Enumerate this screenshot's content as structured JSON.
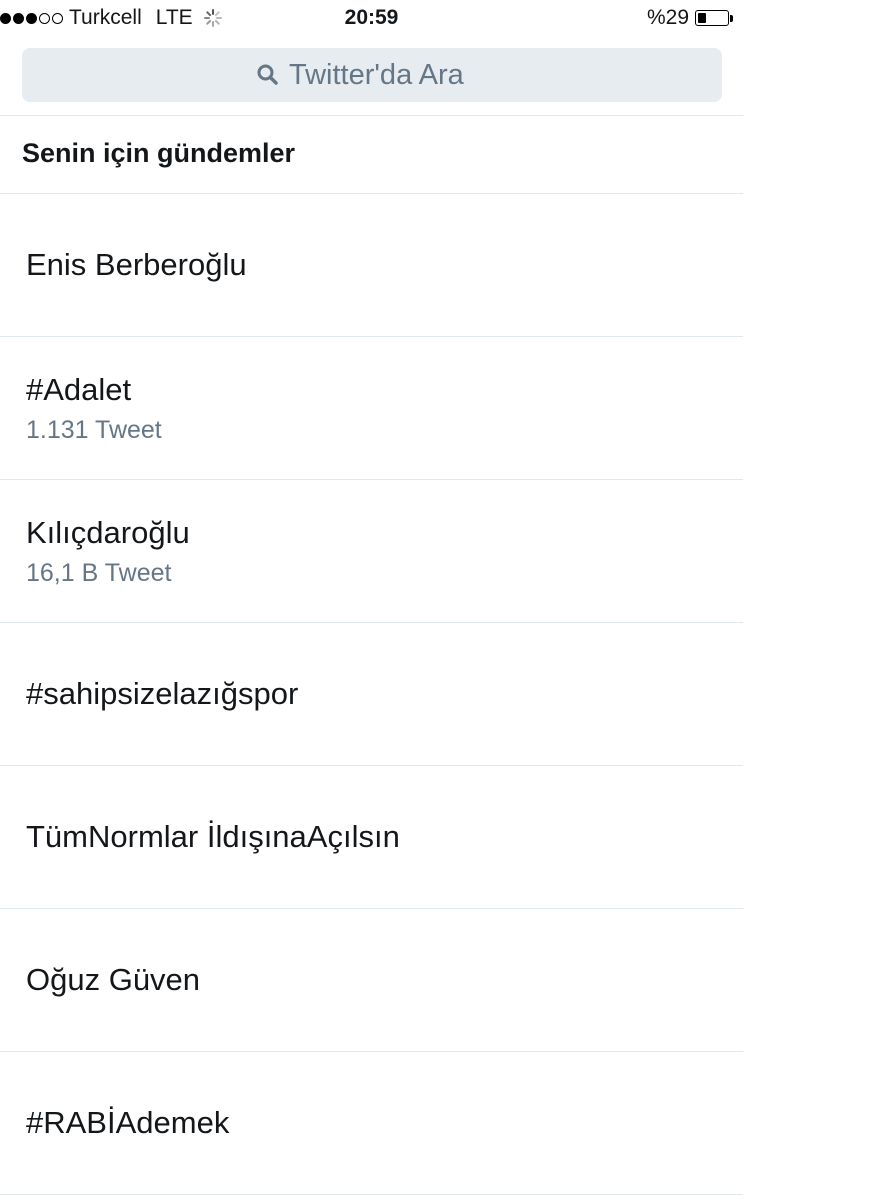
{
  "status_bar": {
    "signal_bars_filled": 3,
    "signal_bars_total": 5,
    "carrier": "Turkcell",
    "network": "LTE",
    "time": "20:59",
    "battery_percent_label": "%29",
    "battery_level": 0.29
  },
  "search": {
    "placeholder": "Twitter'da Ara",
    "value": ""
  },
  "section": {
    "title": "Senin için gündemler"
  },
  "trends": [
    {
      "name": "Enis Berberoğlu",
      "count": ""
    },
    {
      "name": "#Adalet",
      "count": "1.131 Tweet"
    },
    {
      "name": "Kılıçdaroğlu",
      "count": "16,1 B Tweet"
    },
    {
      "name": "#sahipsizelazığspor",
      "count": ""
    },
    {
      "name": "TümNormlar İldışınaAçılsın",
      "count": ""
    },
    {
      "name": "Oğuz Güven",
      "count": ""
    },
    {
      "name": "#RABİAdemek",
      "count": ""
    }
  ],
  "colors": {
    "text_primary": "#14171a",
    "text_secondary": "#657786",
    "search_bg": "#e6ecf0",
    "divider": "#e1e8ed"
  }
}
